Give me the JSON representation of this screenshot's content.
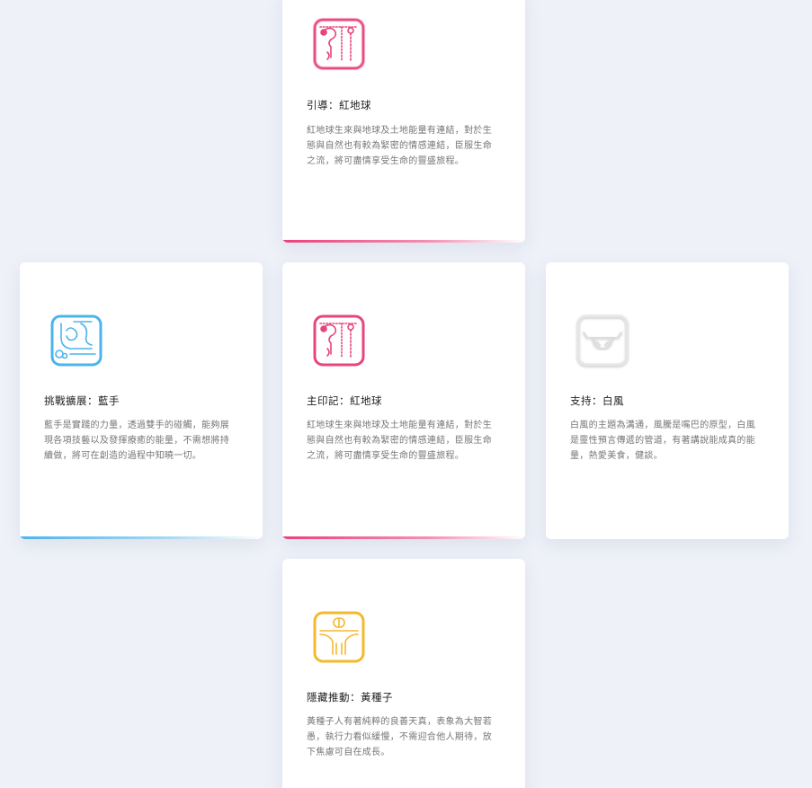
{
  "colors": {
    "red": "#e8457b",
    "blue": "#4db3ec",
    "white": "#d9d9d9",
    "yellow": "#f5b82e"
  },
  "cards": [
    {
      "title": "引導：紅地球",
      "description": "紅地球生來與地球及土地能量有連結，對於生態與自然也有較為緊密的情感連結，臣服生命之流，將可盡情享受生命的豐盛旅程。",
      "icon": "red-earth-glyph-icon",
      "accent": "red"
    },
    {
      "title": "挑戰擴展：藍手",
      "description": "藍手是實踐的力量，透過雙手的碰觸，能夠展現各項技藝以及發揮療癒的能量，不需想將持續做，將可在創造的過程中知曉一切。",
      "icon": "blue-hand-glyph-icon",
      "accent": "blue"
    },
    {
      "title": "主印記：紅地球",
      "description": "紅地球生來與地球及土地能量有連結，對於生態與自然也有較為緊密的情感連結，臣服生命之流，將可盡情享受生命的豐盛旅程。",
      "icon": "red-earth-glyph-icon",
      "accent": "red"
    },
    {
      "title": "支持：白風",
      "description": "白風的主題為溝通，風騰是嘴巴的原型，白風是靈性預言傳遞的管道，有著講說能成真的能量，熱愛美食，健談。",
      "icon": "white-wind-glyph-icon",
      "accent": "none"
    },
    {
      "title": "隱藏推動：黃種子",
      "description": "黃種子人有著純粹的良善天真，表象為大智若愚，執行力看似緩慢，不需迎合他人期待，放下焦慮可自在成長。",
      "icon": "yellow-seed-glyph-icon",
      "accent": "none"
    }
  ]
}
